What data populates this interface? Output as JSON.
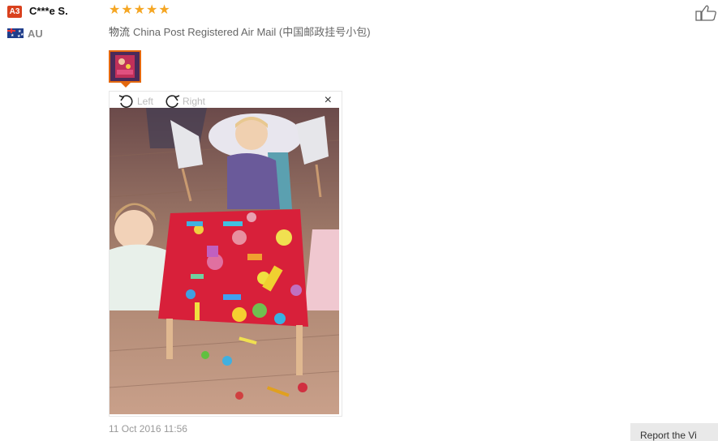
{
  "review": {
    "badge": "A3",
    "username": "C***e S.",
    "country": "AU",
    "rating": 5,
    "logistics_label": "物流",
    "logistics_value": "China Post Registered Air Mail (中国邮政挂号小包)",
    "date": "11 Oct 2016 11:56"
  },
  "viewer": {
    "rotate_left": "Left",
    "rotate_right": "Right",
    "close": "×"
  },
  "footer": {
    "view_button": "Report the Vi"
  },
  "colors": {
    "star": "#f5a623",
    "badge": "#d9411e",
    "thumbnail_border": "#e4680f"
  }
}
